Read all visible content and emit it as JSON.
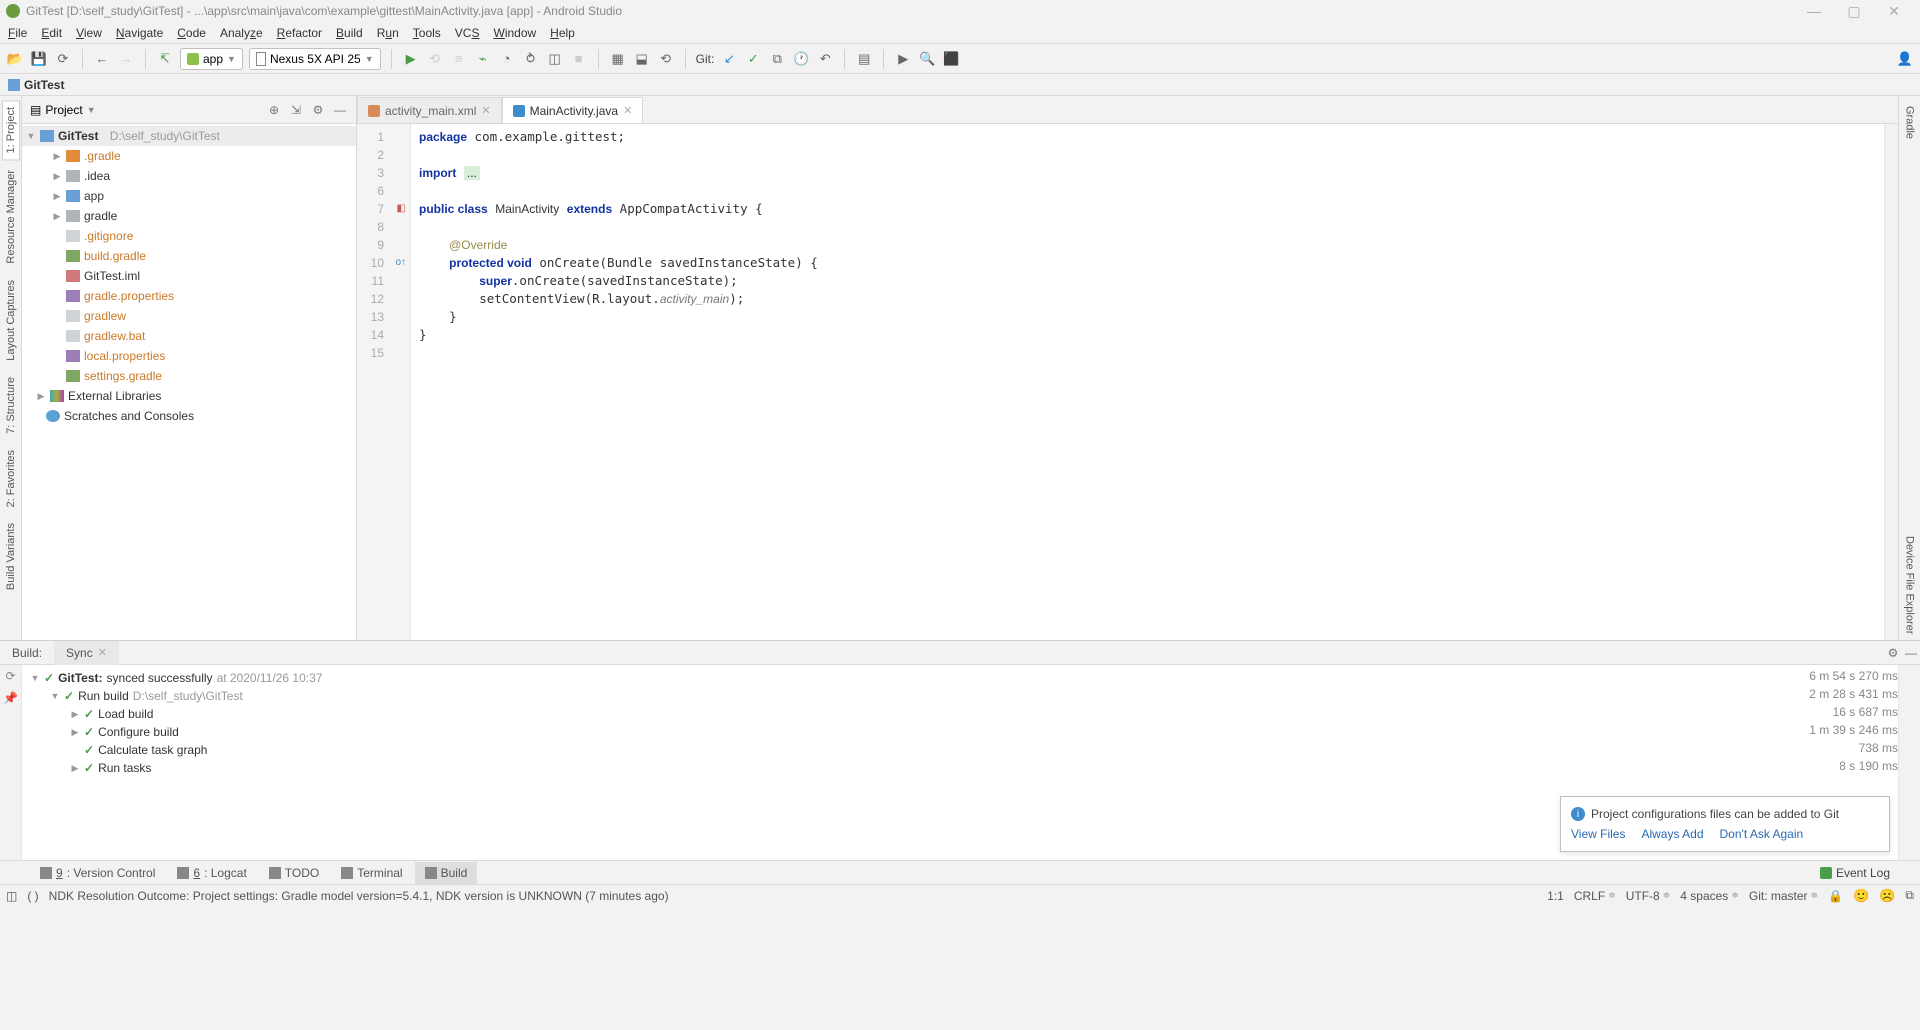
{
  "title": "GitTest [D:\\self_study\\GitTest] - ...\\app\\src\\main\\java\\com\\example\\gittest\\MainActivity.java [app] - Android Studio",
  "menu": [
    "File",
    "Edit",
    "View",
    "Navigate",
    "Code",
    "Analyze",
    "Refactor",
    "Build",
    "Run",
    "Tools",
    "VCS",
    "Window",
    "Help"
  ],
  "toolbar": {
    "app_config": "app",
    "device": "Nexus 5X API 25",
    "git_label": "Git:"
  },
  "breadcrumb": "GitTest",
  "project_header": {
    "title": "Project"
  },
  "tree": {
    "root": {
      "name": "GitTest",
      "path": "D:\\self_study\\GitTest"
    },
    "items": [
      {
        "name": ".gradle",
        "cls": "ic-folder-orange",
        "txt": "orange"
      },
      {
        "name": ".idea",
        "cls": "ic-folder-grey",
        "txt": ""
      },
      {
        "name": "app",
        "cls": "ic-folder-blue",
        "txt": ""
      },
      {
        "name": "gradle",
        "cls": "ic-folder-grey",
        "txt": ""
      },
      {
        "name": ".gitignore",
        "cls": "ic-file",
        "txt": "orange"
      },
      {
        "name": "build.gradle",
        "cls": "ic-gradle",
        "txt": "orange"
      },
      {
        "name": "GitTest.iml",
        "cls": "ic-idea",
        "txt": ""
      },
      {
        "name": "gradle.properties",
        "cls": "ic-prop",
        "txt": "orange"
      },
      {
        "name": "gradlew",
        "cls": "ic-file",
        "txt": "orange"
      },
      {
        "name": "gradlew.bat",
        "cls": "ic-file",
        "txt": "orange"
      },
      {
        "name": "local.properties",
        "cls": "ic-prop",
        "txt": "orange"
      },
      {
        "name": "settings.gradle",
        "cls": "ic-gradle",
        "txt": "orange"
      }
    ],
    "ext_lib": "External Libraries",
    "scratches": "Scratches and Consoles"
  },
  "editor": {
    "tabs": [
      {
        "name": "activity_main.xml",
        "active": false,
        "fi": "fi-xml"
      },
      {
        "name": "MainActivity.java",
        "active": true,
        "fi": "fi-java"
      }
    ],
    "line_numbers": [
      "1",
      "2",
      "3",
      "6",
      "7",
      "8",
      "9",
      "10",
      "11",
      "12",
      "13",
      "14",
      "15"
    ]
  },
  "left_tabs": [
    "1: Project",
    "Resource Manager",
    "Layout Captures",
    "7: Structure",
    "2: Favorites",
    "Build Variants"
  ],
  "right_tabs": [
    "Gradle",
    "Device File Explorer"
  ],
  "build": {
    "tabs": [
      "Build:",
      "Sync"
    ],
    "rows": [
      {
        "depth": 0,
        "exp": "▼",
        "bold": "GitTest:",
        "text": " synced successfully ",
        "grey": "at 2020/11/26 10:37"
      },
      {
        "depth": 1,
        "exp": "▼",
        "text": "Run build ",
        "grey": "D:\\self_study\\GitTest"
      },
      {
        "depth": 2,
        "exp": "▶",
        "text": "Load build"
      },
      {
        "depth": 2,
        "exp": "▶",
        "text": "Configure build"
      },
      {
        "depth": 2,
        "exp": "",
        "text": "Calculate task graph"
      },
      {
        "depth": 2,
        "exp": "▶",
        "text": "Run tasks"
      }
    ],
    "times": [
      "6 m 54 s 270 ms",
      "2 m 28 s 431 ms",
      "16 s 687 ms",
      "1 m 39 s 246 ms",
      "738 ms",
      "8 s 190 ms"
    ]
  },
  "notif": {
    "title": "Project configurations files can be added to Git",
    "links": [
      "View Files",
      "Always Add",
      "Don't Ask Again"
    ]
  },
  "bottom_tools": [
    {
      "label": "9: Version Control"
    },
    {
      "label": "6: Logcat"
    },
    {
      "label": "TODO"
    },
    {
      "label": "Terminal"
    },
    {
      "label": "Build",
      "active": true
    }
  ],
  "event_log": "Event Log",
  "status": {
    "msg": "NDK Resolution Outcome: Project settings: Gradle model version=5.4.1, NDK version is UNKNOWN (7 minutes ago)",
    "pos": "1:1",
    "le": "CRLF",
    "enc": "UTF-8",
    "indent": "4 spaces",
    "branch": "Git: master"
  }
}
